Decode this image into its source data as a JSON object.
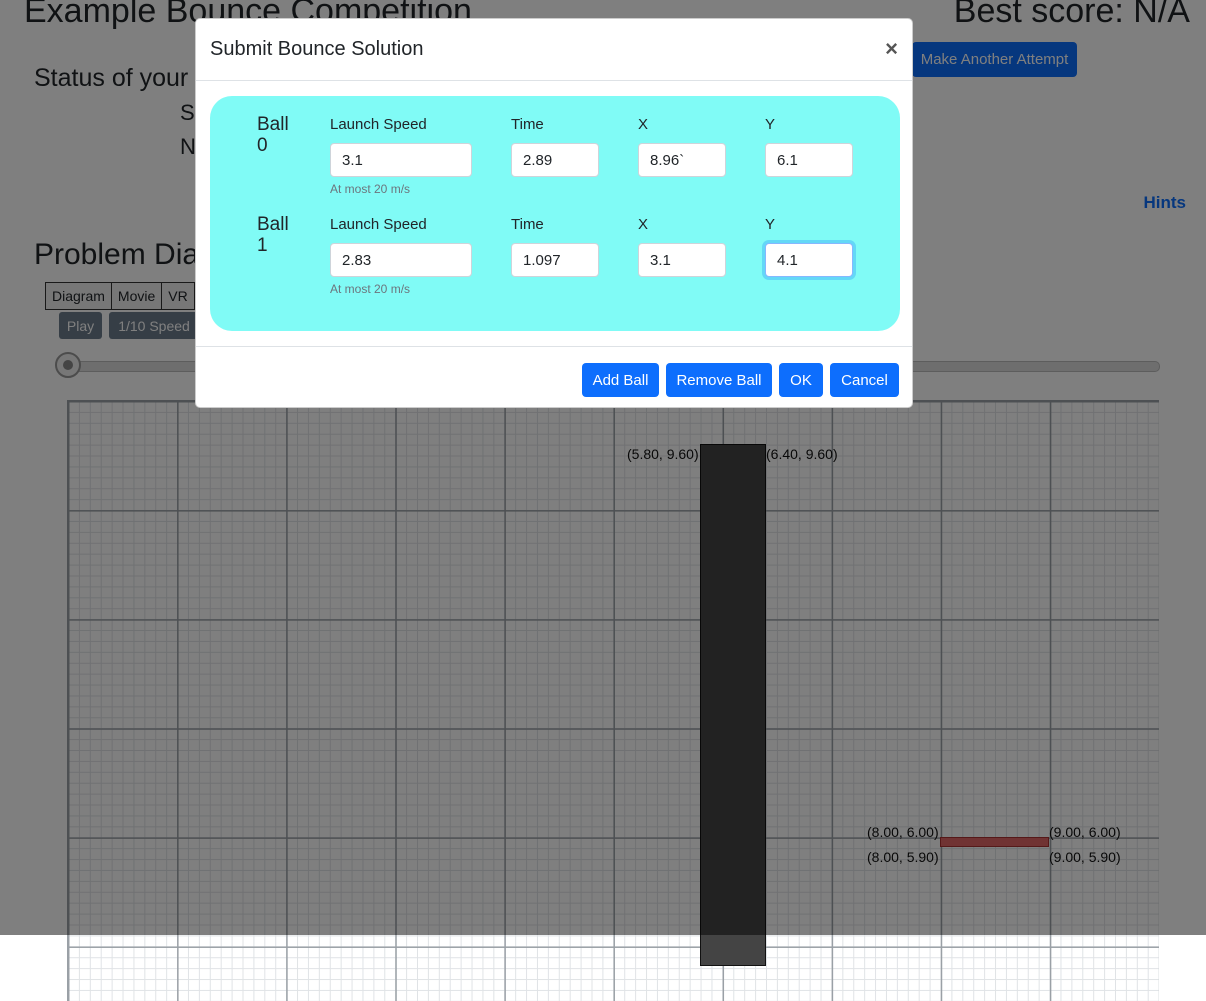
{
  "page": {
    "title": "Example Bounce Competition",
    "best_score": "Best score: N/A",
    "status_heading": "Status of your",
    "status_line1": "S",
    "status_line2": "N",
    "make_attempt_label": "Make Another Attempt",
    "hints_label": "Hints",
    "problem_heading": "Problem Diag",
    "tabs": [
      "Diagram",
      "Movie",
      "VR"
    ],
    "play_label": "Play",
    "speed_label": "1/10 Speed"
  },
  "diagram": {
    "labels": {
      "wall_top_left": "(5.80, 9.60)",
      "wall_top_right": "(6.40, 9.60)",
      "target_top_left": "(8.00, 6.00)",
      "target_top_right": "(9.00, 6.00)",
      "target_bottom_left": "(8.00, 5.90)",
      "target_bottom_right": "(9.00, 5.90)"
    }
  },
  "modal": {
    "title": "Submit Bounce Solution",
    "close_symbol": "×",
    "column_labels": {
      "speed": "Launch Speed",
      "time": "Time",
      "x": "X",
      "y": "Y"
    },
    "speed_help": "At most 20 m/s",
    "balls": [
      {
        "label_word": "Ball",
        "index": "0",
        "speed": "3.1",
        "time": "2.89",
        "x": "8.96`",
        "y": "6.1"
      },
      {
        "label_word": "Ball",
        "index": "1",
        "speed": "2.83",
        "time": "1.097",
        "x": "3.1",
        "y": "4.1"
      }
    ],
    "buttons": {
      "add": "Add Ball",
      "remove": "Remove Ball",
      "ok": "OK",
      "cancel": "Cancel"
    }
  }
}
